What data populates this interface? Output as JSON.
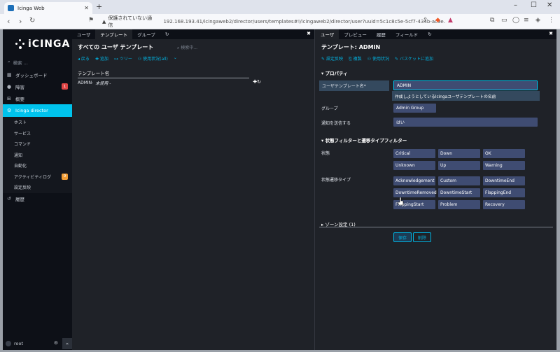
{
  "browser": {
    "tab_title": "Icinga Web",
    "insecure_label": "保護されていない通信",
    "url": "192.168.193.41/icingaweb2/director/users/templates#!/icingaweb2/director/user?uuid=5c1c8c5e-5cf7-434b-ac9e..."
  },
  "sidebar": {
    "logo": "iCINGA",
    "search_placeholder": "検索 ...",
    "items": [
      {
        "label": "ダッシュボード"
      },
      {
        "label": "障害",
        "badge": "1"
      },
      {
        "label": "概要"
      },
      {
        "label": "Icinga director"
      }
    ],
    "director_sub": [
      {
        "label": "ホスト"
      },
      {
        "label": "サービス"
      },
      {
        "label": "コマンド"
      },
      {
        "label": "通知"
      },
      {
        "label": "自動化"
      },
      {
        "label": "アクティビティログ",
        "badge": "9"
      },
      {
        "label": "設定反映"
      }
    ],
    "history": "履歴",
    "user": "root"
  },
  "left": {
    "tabs": [
      "ユーザ",
      "テンプレート",
      "グループ"
    ],
    "title": "すべての ユーザ テンプレート",
    "search_placeholder": "検索中...",
    "actions": [
      "戻る",
      "追加",
      "ツリー",
      "使用状況(all)"
    ],
    "column_header": "テンプレート名",
    "row_name": "ADMIN-",
    "row_status": "未使用 -"
  },
  "right": {
    "tabs": [
      "ユーザ",
      "プレビュー",
      "履歴",
      "フィールド"
    ],
    "title": "テンプレート: ADMIN",
    "actions": [
      "設定反映",
      "複製",
      "使用状況",
      "バスケットに追加"
    ],
    "section_props": "プロパティ",
    "field_template_label": "ユーザテンプレート名*",
    "field_template_value": "ADMIN",
    "field_template_hint": "作成しようとしているIcingaユーザテンプレートの名前",
    "field_group_label": "グループ",
    "field_group_value": "Admin Group",
    "field_notify_label": "通知を送信する",
    "field_notify_value": "はい",
    "section_filters": "状態フィルターと遷移タイプフィルター",
    "states_label": "状態",
    "states": [
      "Critical",
      "Down",
      "OK",
      "Unknown",
      "Up",
      "Warning"
    ],
    "transitions_label": "状態遷移タイプ",
    "transitions": [
      "Acknowledgement",
      "Custom",
      "DowntimeEnd",
      "DowntimeRemoved",
      "DowntimeStart",
      "FlappingEnd",
      "FlappingStart",
      "Problem",
      "Recovery"
    ],
    "section_zone": "ゾーン設定 (1)",
    "save_label": "保存",
    "delete_label": "削除"
  },
  "colors": {
    "accent": "#00c3ed",
    "chip": "#3f4c72",
    "sidebar_bg": "#0d1017",
    "content_bg": "#1f2228"
  }
}
